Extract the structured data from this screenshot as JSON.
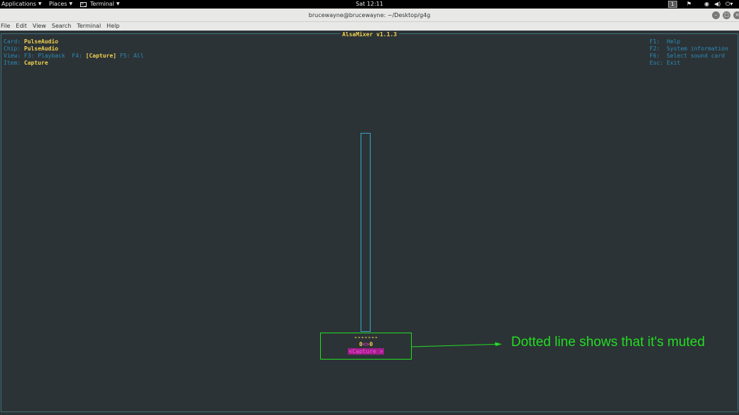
{
  "topbar": {
    "applications": "Applications",
    "places": "Places",
    "terminal": "Terminal",
    "clock": "Sat 12:11",
    "workspace": "1",
    "tray_icons": [
      "people-icon",
      "network-icon",
      "volume-icon",
      "power-icon"
    ]
  },
  "window": {
    "title": "brucewayne@brucewayne: ~/Desktop/g4g",
    "buttons": [
      "minimize-button",
      "maximize-button",
      "close-button"
    ]
  },
  "menu": [
    "File",
    "Edit",
    "View",
    "Search",
    "Terminal",
    "Help"
  ],
  "alsamixer": {
    "title": "AlsaMixer v1.1.3",
    "card_label": "Card:",
    "card_value": "PulseAudio",
    "chip_label": "Chip:",
    "chip_value": "PulseAudio",
    "view_label": "View:",
    "view_f3": "F3: Playback",
    "view_f4_key": "F4:",
    "view_f4_value": "[Capture]",
    "view_f5": "F5: All",
    "item_label": "Item:",
    "item_value": "Capture",
    "help": [
      "F1:  Help",
      "F2:  System information",
      "F6:  Select sound card",
      "Esc: Exit"
    ],
    "muted_dots": "-------",
    "level_left": "0",
    "level_sep": "<>",
    "level_right": "0",
    "control_label": "<Capture >"
  },
  "annotation": {
    "text": "Dotted line shows that it's muted",
    "color": "#22dd22"
  },
  "colors": {
    "terminal_bg": "#2c3336",
    "alsa_key": "#2b8bb8",
    "alsa_value": "#f0d050",
    "alsa_magenta": "#d83ac0"
  }
}
